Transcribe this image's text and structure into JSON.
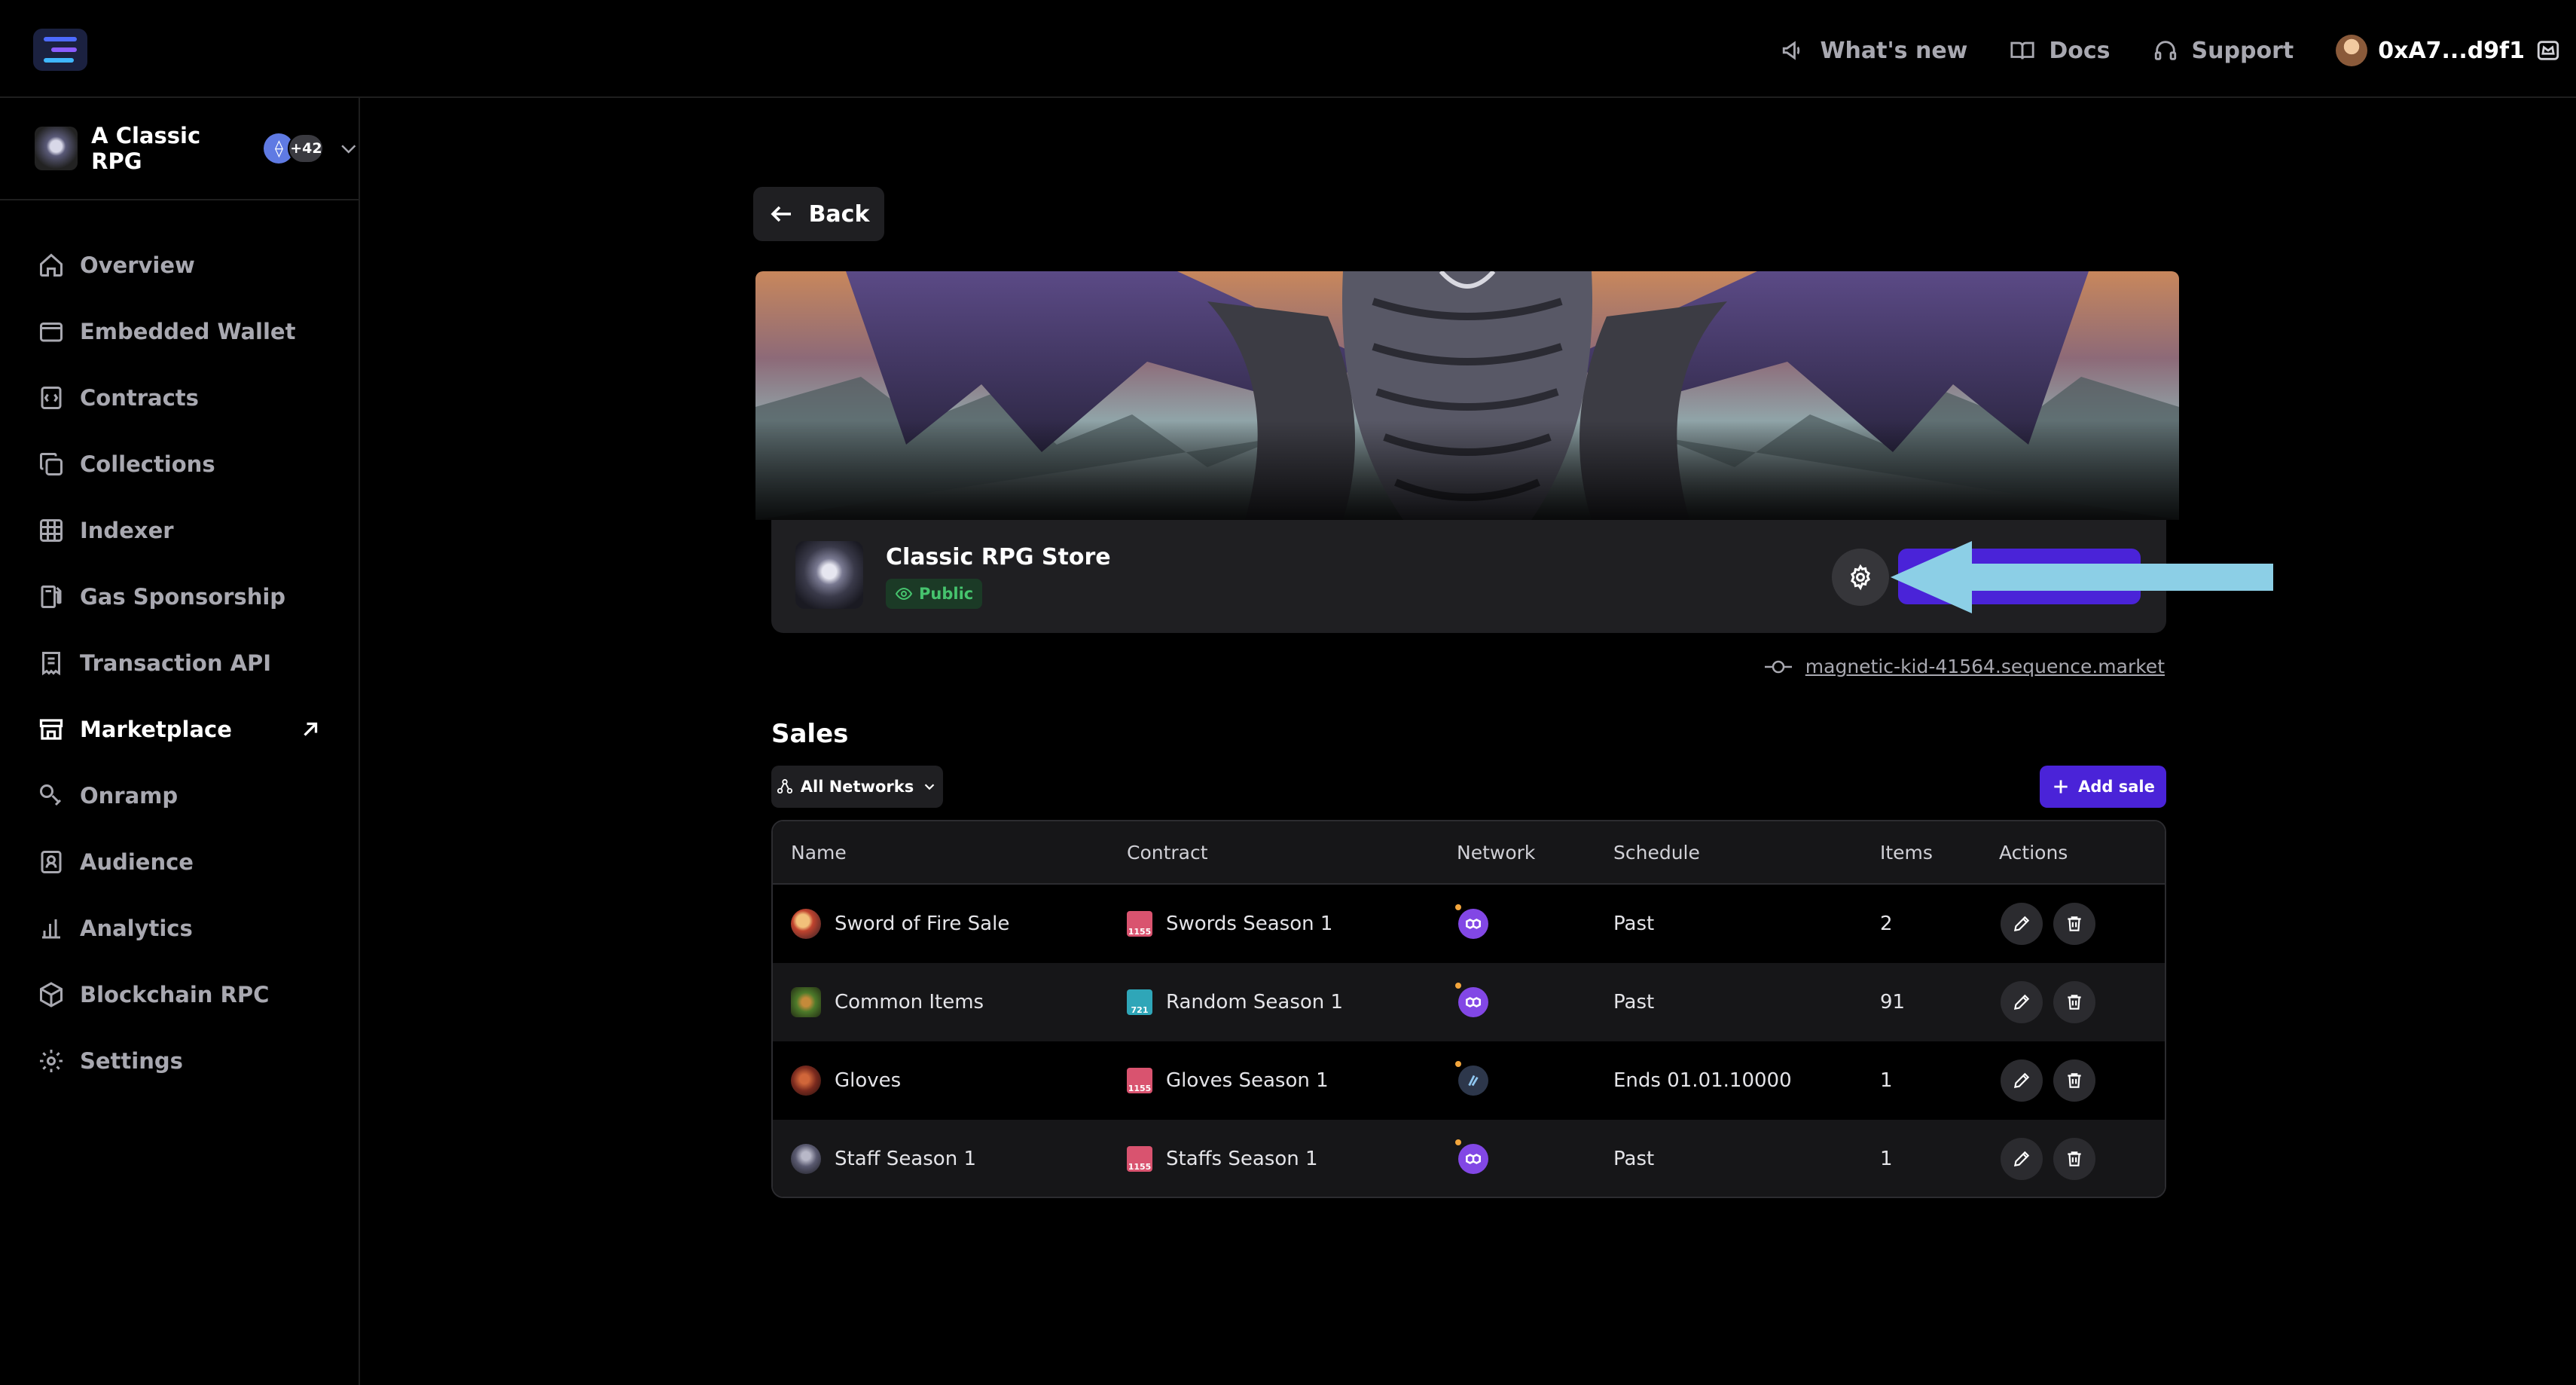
{
  "topbar": {
    "whats_new": "What's new",
    "docs": "Docs",
    "support": "Support",
    "wallet_address": "0xA7...d9f1"
  },
  "project": {
    "name": "A Classic RPG",
    "extra_chains": "+42"
  },
  "sidebar": {
    "items": [
      {
        "label": "Overview",
        "icon": "home-icon"
      },
      {
        "label": "Embedded Wallet",
        "icon": "wallet-icon"
      },
      {
        "label": "Contracts",
        "icon": "contract-icon"
      },
      {
        "label": "Collections",
        "icon": "collections-icon"
      },
      {
        "label": "Indexer",
        "icon": "grid-icon"
      },
      {
        "label": "Gas Sponsorship",
        "icon": "gas-icon"
      },
      {
        "label": "Transaction API",
        "icon": "receipt-icon"
      },
      {
        "label": "Marketplace",
        "icon": "storefront-icon",
        "active": true
      },
      {
        "label": "Onramp",
        "icon": "onramp-icon"
      },
      {
        "label": "Audience",
        "icon": "audience-icon"
      },
      {
        "label": "Analytics",
        "icon": "bar-chart-icon"
      },
      {
        "label": "Blockchain RPC",
        "icon": "cube-icon"
      },
      {
        "label": "Settings",
        "icon": "gear-icon"
      }
    ]
  },
  "main": {
    "back_label": "Back",
    "store": {
      "title": "Classic RPG Store",
      "visibility": "Public",
      "url": "magnetic-kid-41564.sequence.market"
    },
    "sales": {
      "title": "Sales",
      "filter_label": "All Networks",
      "add_label": "Add sale",
      "columns": [
        "Name",
        "Contract",
        "Network",
        "Schedule",
        "Items",
        "Actions"
      ],
      "rows": [
        {
          "name": "Sword of Fire Sale",
          "contract": "Swords Season 1",
          "contract_type": "1155",
          "network": "polygon",
          "schedule": "Past",
          "items": "2"
        },
        {
          "name": "Common Items",
          "contract": "Random Season 1",
          "contract_type": "721",
          "network": "polygon",
          "schedule": "Past",
          "items": "91"
        },
        {
          "name": "Gloves",
          "contract": "Gloves Season 1",
          "contract_type": "1155",
          "network": "arbitrum",
          "schedule": "Ends 01.01.10000",
          "items": "1"
        },
        {
          "name": "Staff Season 1",
          "contract": "Staffs Season 1",
          "contract_type": "1155",
          "network": "polygon",
          "schedule": "Past",
          "items": "1"
        }
      ]
    }
  },
  "colors": {
    "accent": "#4a23d8",
    "public_badge": "#46c46e",
    "annotation_arrow": "#8ccfe6",
    "polygon": "#8247e5",
    "arbitrum": "#2d374b"
  }
}
